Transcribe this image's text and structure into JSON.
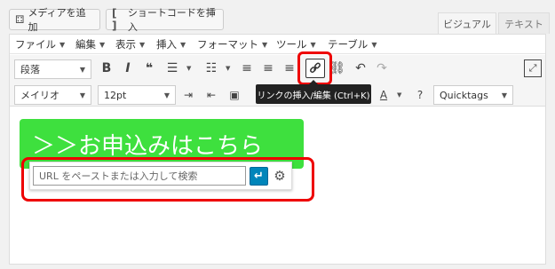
{
  "header": {
    "add_media_label": "メディアを追加",
    "insert_shortcode_label": "ショートコードを挿入"
  },
  "tabs": [
    {
      "label": "ビジュアル",
      "active": true
    },
    {
      "label": "テキスト",
      "active": false
    }
  ],
  "menubar": [
    {
      "label": "ファイル"
    },
    {
      "label": "編集"
    },
    {
      "label": "表示"
    },
    {
      "label": "挿入"
    },
    {
      "label": "フォーマット"
    },
    {
      "label": "ツール"
    },
    {
      "label": "テーブル"
    }
  ],
  "toolbar1": {
    "format_select": "段落",
    "link_tooltip": "リンクの挿入/編集 (Ctrl+K)"
  },
  "toolbar2": {
    "font_select": "メイリオ",
    "size_select": "12pt",
    "quicktags_select": "Quicktags"
  },
  "content": {
    "button_text": "＞＞お申込みはこちら",
    "link_input_placeholder": "URL をペーストまたは入力して検索",
    "apply_icon": "↵"
  },
  "colors": {
    "highlight_red": "#e00000",
    "button_green": "#3ee03e",
    "apply_blue": "#0085ba"
  }
}
